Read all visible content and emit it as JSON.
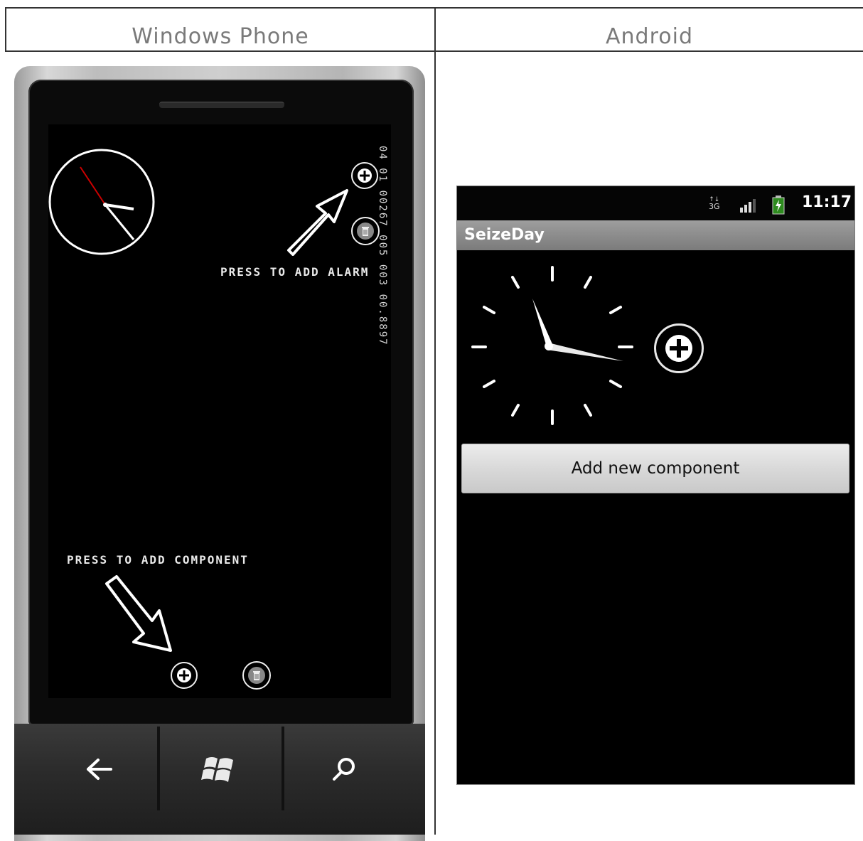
{
  "headers": {
    "left": "Windows Phone",
    "right": "Android"
  },
  "windows_phone": {
    "alarm_hint": "PRESS TO ADD ALARM",
    "component_hint": "PRESS TO ADD COMPONENT",
    "vertical_readout": "04 01 00267 005 003 00.8897",
    "icons": {
      "add": "plus-circle-icon",
      "delete": "trash-icon",
      "back": "back-arrow-icon",
      "start": "windows-logo-icon",
      "search": "search-icon"
    }
  },
  "android": {
    "app_title": "SeizeDay",
    "status_time": "11:17",
    "network_label": "3G",
    "add_component_label": "Add new component",
    "icons": {
      "add": "plus-circle-icon",
      "signal": "signal-icon",
      "battery": "battery-charging-icon",
      "network": "3g-icon"
    }
  }
}
